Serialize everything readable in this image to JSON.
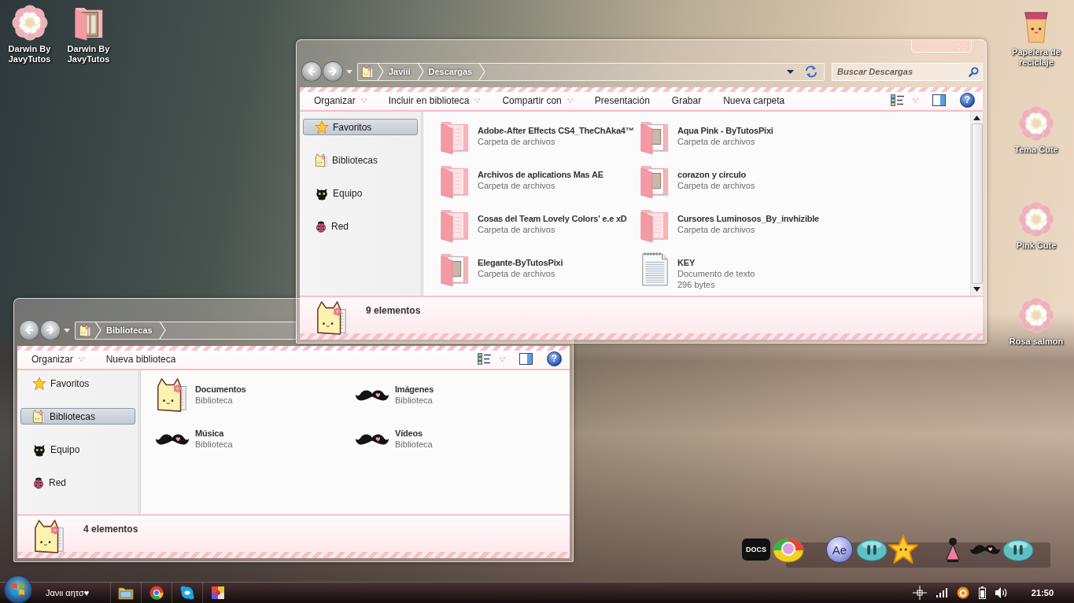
{
  "desktop": {
    "left_icons": [
      {
        "label": "Darwin By JavyTutos",
        "kind": "flower"
      },
      {
        "label": "Darwin By JavyTutos",
        "kind": "folder-photo"
      }
    ],
    "right_icons": [
      {
        "label": "Papelera de reciclaje",
        "kind": "bin"
      },
      {
        "label": "Tema Cute",
        "kind": "flower"
      },
      {
        "label": "Pink Cute",
        "kind": "flower"
      },
      {
        "label": "Rosa salmon",
        "kind": "flower"
      }
    ]
  },
  "windows": [
    {
      "window_controls": [
        {
          "kind": "minimize"
        },
        {
          "kind": "maximize"
        },
        {
          "kind": "close"
        }
      ],
      "breadcrumb": [
        "Javiii",
        "Descargas"
      ],
      "address_tools": [
        {
          "kind": "history"
        },
        {
          "kind": "refresh"
        }
      ],
      "search": {
        "placeholder": "Buscar Descargas"
      },
      "toolbar": [
        {
          "label": "Organizar",
          "has_menu": true
        },
        {
          "label": "Incluir en biblioteca",
          "has_menu": true
        },
        {
          "label": "Compartir con",
          "has_menu": true
        },
        {
          "label": "Presentación",
          "has_menu": false
        },
        {
          "label": "Grabar",
          "has_menu": false
        },
        {
          "label": "Nueva carpeta",
          "has_menu": false
        }
      ],
      "help": "?",
      "nav": [
        {
          "label": "Favoritos",
          "kind": "star",
          "selected": true
        },
        {
          "label": "Bibliotecas",
          "kind": "library",
          "selected": false
        },
        {
          "label": "Equipo",
          "kind": "computer",
          "selected": false
        },
        {
          "label": "Red",
          "kind": "network",
          "selected": false
        }
      ],
      "items": [
        {
          "name": "Adobe-After Effects CS4_TheChAka4™",
          "details": [
            "Carpeta de archivos"
          ],
          "kind": "folder"
        },
        {
          "name": "Aqua Pink - ByTutosPixi",
          "details": [
            "Carpeta de archivos"
          ],
          "kind": "folder-papers"
        },
        {
          "name": "Archivos de aplications Mas AE",
          "details": [
            "Carpeta de archivos"
          ],
          "kind": "folder"
        },
        {
          "name": "corazon y circulo",
          "details": [
            "Carpeta de archivos"
          ],
          "kind": "folder-papers"
        },
        {
          "name": "Cosas del Team Lovely Colors' e.e xD",
          "details": [
            "Carpeta de archivos"
          ],
          "kind": "folder"
        },
        {
          "name": "Cursores Luminosos_By_invhizible",
          "details": [
            "Carpeta de archivos"
          ],
          "kind": "folder"
        },
        {
          "name": "Elegante-ByTutosPixi",
          "details": [
            "Carpeta de archivos"
          ],
          "kind": "folder-papers"
        },
        {
          "name": "KEY",
          "details": [
            "Documento de texto",
            "296 bytes"
          ],
          "kind": "text-file"
        }
      ],
      "scrollbar": true,
      "status": "9 elementos"
    },
    {
      "breadcrumb": [
        "Bibliotecas"
      ],
      "toolbar": [
        {
          "label": "Organizar",
          "has_menu": true
        },
        {
          "label": "Nueva biblioteca",
          "has_menu": false
        }
      ],
      "help": "?",
      "nav": [
        {
          "label": "Favoritos",
          "kind": "star",
          "selected": false
        },
        {
          "label": "Bibliotecas",
          "kind": "library",
          "selected": true
        },
        {
          "label": "Equipo",
          "kind": "computer",
          "selected": false
        },
        {
          "label": "Red",
          "kind": "network",
          "selected": false
        }
      ],
      "items": [
        {
          "name": "Documentos",
          "details": [
            "Biblioteca"
          ],
          "kind": "cat-folder"
        },
        {
          "name": "Imágenes",
          "details": [
            "Biblioteca"
          ],
          "kind": "mustache"
        },
        {
          "name": "Música",
          "details": [
            "Biblioteca"
          ],
          "kind": "mustache"
        },
        {
          "name": "Vídeos",
          "details": [
            "Biblioteca"
          ],
          "kind": "mustache"
        }
      ],
      "status": "4 elementos"
    }
  ],
  "dock": [
    {
      "kind": "docs",
      "label": "DOCS"
    },
    {
      "kind": "ball"
    },
    {
      "kind": "ae",
      "label": "Ae"
    },
    {
      "kind": "pause"
    },
    {
      "kind": "star"
    },
    {
      "kind": "figure"
    },
    {
      "kind": "mustache"
    },
    {
      "kind": "pause"
    }
  ],
  "taskbar": {
    "user": "Jανιι αητσ♥",
    "apps": [
      {
        "kind": "folder"
      },
      {
        "kind": "browser"
      },
      {
        "kind": "chat"
      },
      {
        "kind": "paint"
      }
    ],
    "tray": [
      {
        "kind": "crosshair"
      },
      {
        "kind": "signal"
      },
      {
        "kind": "ring"
      },
      {
        "kind": "battery"
      },
      {
        "kind": "speaker"
      }
    ],
    "clock": "21:50"
  }
}
